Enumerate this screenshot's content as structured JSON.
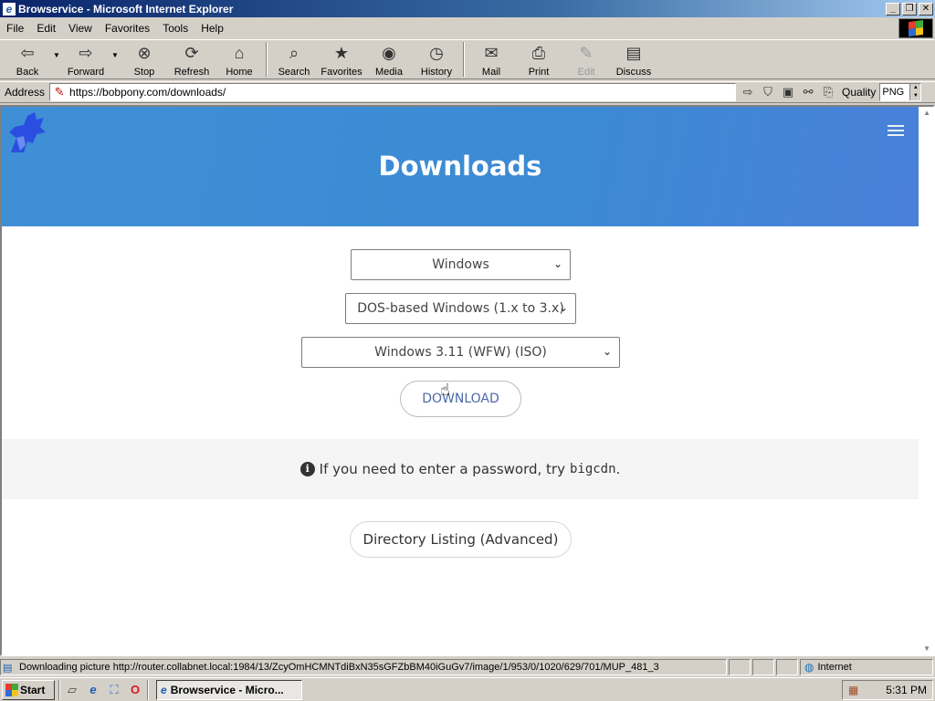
{
  "window": {
    "title": "Browservice - Microsoft Internet Explorer",
    "buttons": {
      "minimize": "_",
      "maximize": "❐",
      "close": "✕"
    }
  },
  "menubar": {
    "items": [
      "File",
      "Edit",
      "View",
      "Favorites",
      "Tools",
      "Help"
    ]
  },
  "toolbar": {
    "back": "Back",
    "forward": "Forward",
    "stop": "Stop",
    "refresh": "Refresh",
    "home": "Home",
    "search": "Search",
    "favorites": "Favorites",
    "media": "Media",
    "history": "History",
    "mail": "Mail",
    "print": "Print",
    "edit": "Edit",
    "discuss": "Discuss"
  },
  "address": {
    "label": "Address",
    "url": "https://bobpony.com/downloads/",
    "quality_label": "Quality",
    "quality_value": "PNG"
  },
  "page": {
    "title": "Downloads",
    "os_select": "Windows",
    "family_select": "DOS-based Windows (1.x to 3.x)",
    "version_select": "Windows 3.11 (WFW) (ISO)",
    "download_button": "DOWNLOAD",
    "info_text": "If you need to enter a password, try",
    "info_password": "bigcdn",
    "info_period": ".",
    "directory_button": "Directory Listing (Advanced)"
  },
  "statusbar": {
    "text": "Downloading picture http://router.collabnet.local:1984/13/ZcyOmHCMNTdiBxN35sGFZbBM40iGuGv7/image/1/953/0/1020/629/701/MUP_481_3",
    "zone": "Internet"
  },
  "taskbar": {
    "start": "Start",
    "task": "Browservice - Micro...",
    "clock": "5:31 PM"
  },
  "colors": {
    "hero_gradient_start": "#3f8fd6",
    "hero_gradient_end": "#4a80d8",
    "download_text": "#4b69a8",
    "titlebar": "#0a246a"
  }
}
